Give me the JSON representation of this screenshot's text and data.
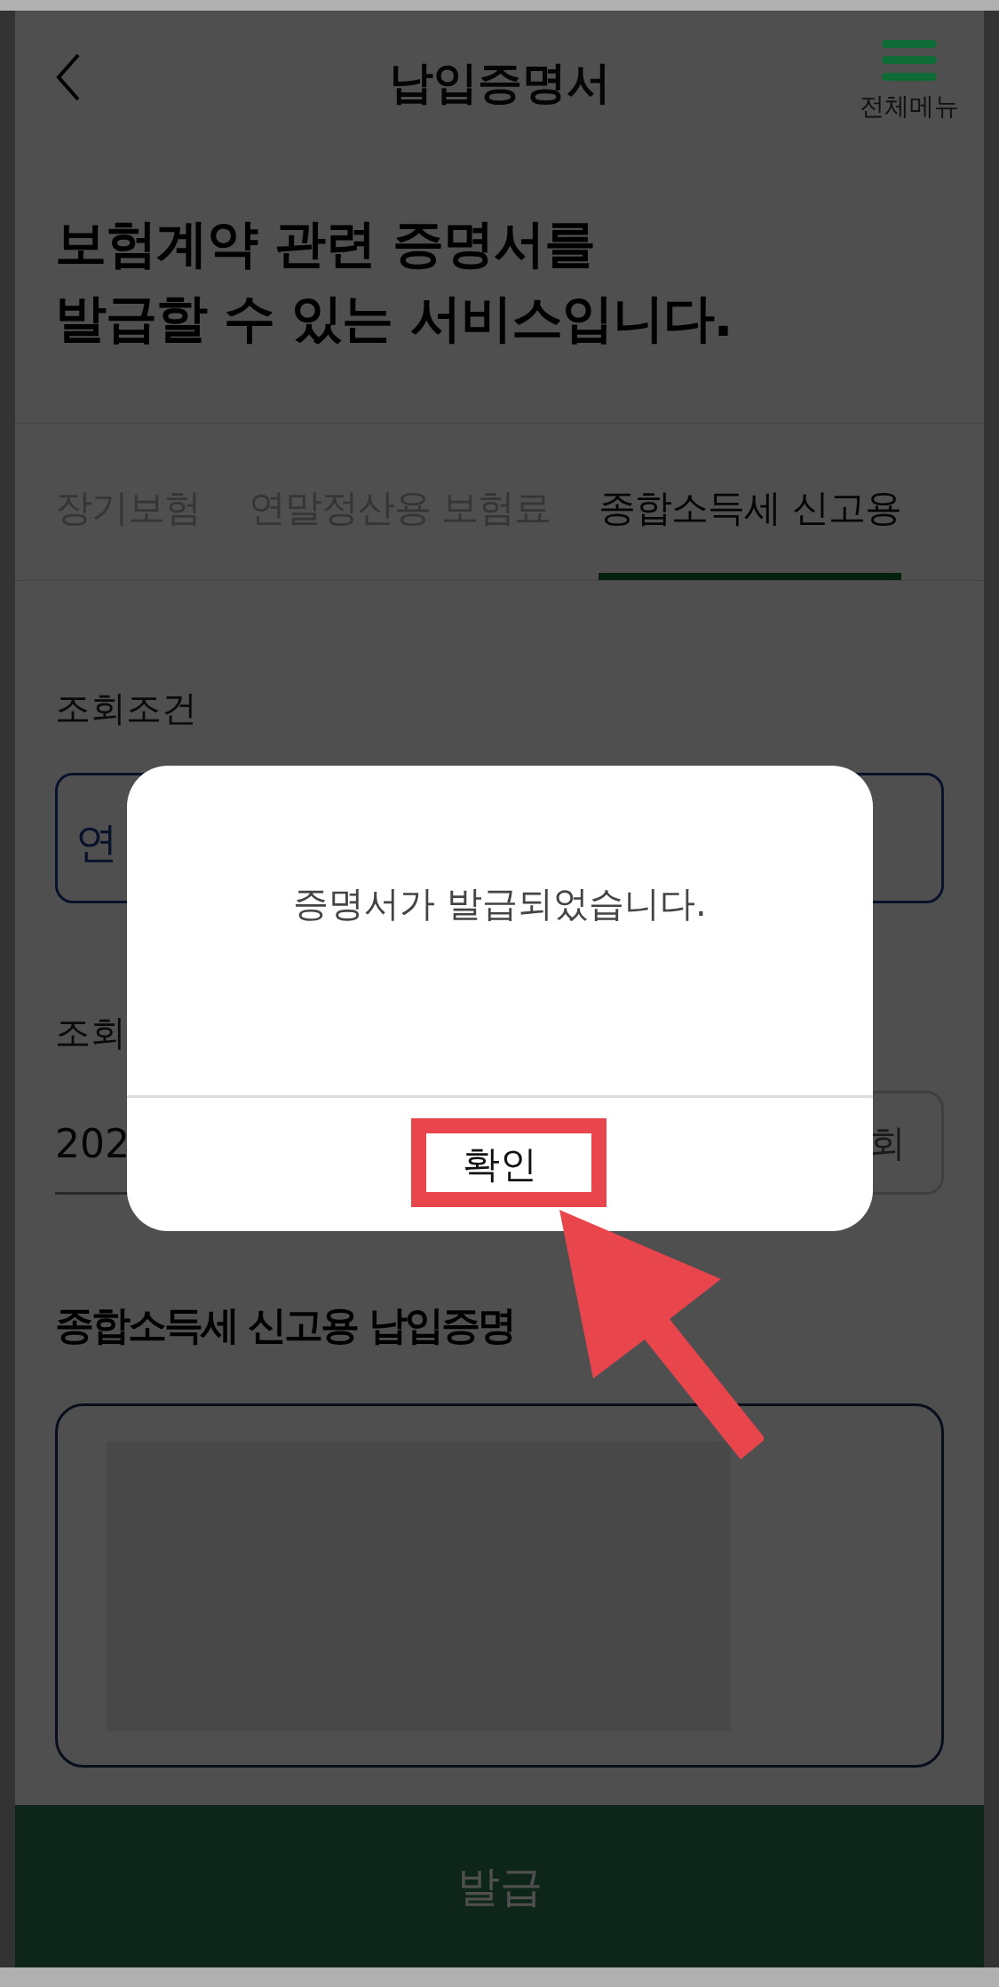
{
  "header": {
    "title": "납입증명서",
    "menu_label": "전체메뉴"
  },
  "heading": [
    "보험계약 관련 증명서를",
    "발급할 수 있는 서비스입니다."
  ],
  "tabs": [
    {
      "label": "장기보험",
      "selected": false
    },
    {
      "label": "연말정산용 보험료",
      "selected": false
    },
    {
      "label": "종합소득세 신고용",
      "selected": true
    }
  ],
  "search": {
    "label": "조회조건",
    "field_value": "연"
  },
  "period": {
    "label": "조회",
    "value": "202",
    "button": "회"
  },
  "list": {
    "title": "종합소득세 신고용 납입증명"
  },
  "issue_button": "발급",
  "dialog": {
    "message": "증명서가 발급되었습니다.",
    "confirm": "확인"
  }
}
